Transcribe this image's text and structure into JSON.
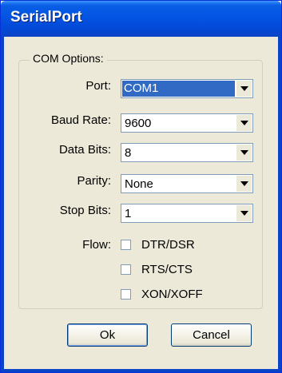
{
  "window": {
    "title": "SerialPort"
  },
  "group": {
    "label": "COM Options:"
  },
  "fields": [
    {
      "label": "Port:",
      "value": "COM1"
    },
    {
      "label": "Baud Rate:",
      "value": "9600"
    },
    {
      "label": "Data Bits:",
      "value": "8"
    },
    {
      "label": "Parity:",
      "value": "None"
    },
    {
      "label": "Stop Bits:",
      "value": "1"
    }
  ],
  "flow": {
    "label": "Flow:",
    "options": [
      {
        "label": "DTR/DSR",
        "checked": false
      },
      {
        "label": "RTS/CTS",
        "checked": false
      },
      {
        "label": "XON/XOFF",
        "checked": false
      }
    ]
  },
  "buttons": {
    "ok": "Ok",
    "cancel": "Cancel"
  }
}
